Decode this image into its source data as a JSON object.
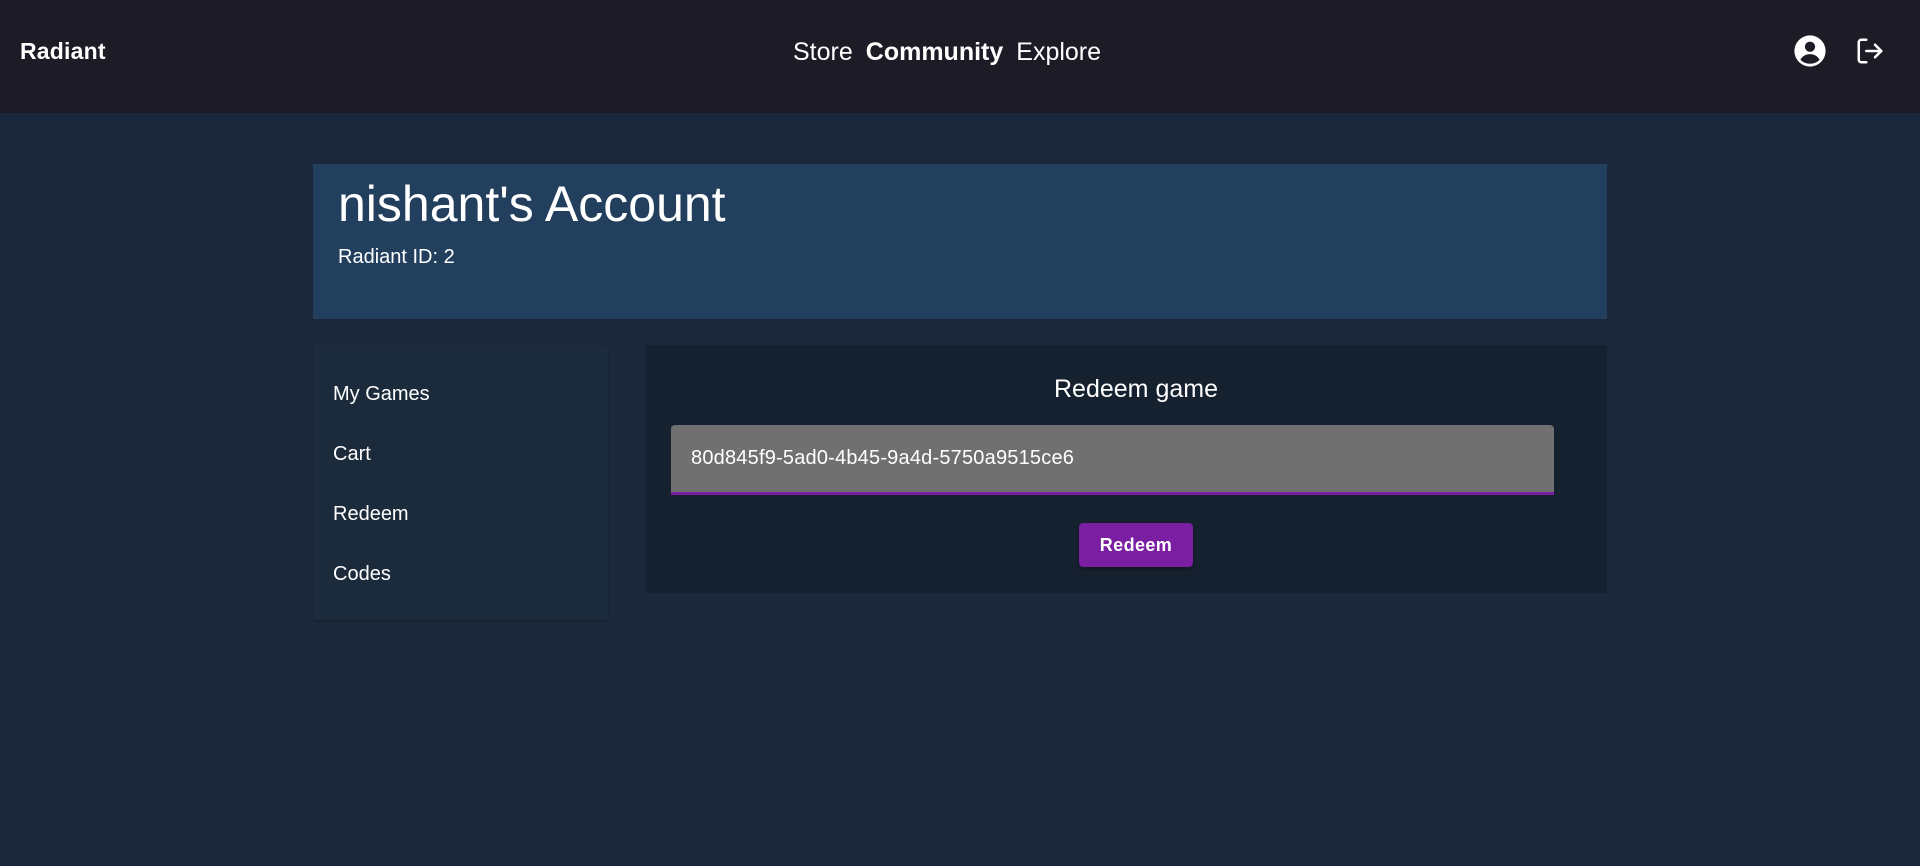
{
  "app": {
    "brand": "Radiant"
  },
  "nav": {
    "links": [
      {
        "label": "Store",
        "active": false
      },
      {
        "label": "Community",
        "active": true
      },
      {
        "label": "Explore",
        "active": false
      }
    ],
    "icons": [
      "account-circle-icon",
      "logout-icon"
    ]
  },
  "account": {
    "title": "nishant's Account",
    "id_text": "Radiant ID: 2"
  },
  "side_menu": {
    "items": [
      {
        "label": "My Games"
      },
      {
        "label": "Cart"
      },
      {
        "label": "Redeem"
      },
      {
        "label": "Codes"
      }
    ]
  },
  "redeem": {
    "title": "Redeem game",
    "code_value": "80d845f9-5ad0-4b45-9a4d-5750a9515ce6",
    "button_label": "Redeem"
  },
  "colors": {
    "topbar": "#1c1b26",
    "page_background": "#1b283b",
    "account_header": "#233f5e",
    "side_menu": "#1c2b3c",
    "redeem_panel": "#162130",
    "input_background": "#707070",
    "accent": "#7b1fa2"
  }
}
